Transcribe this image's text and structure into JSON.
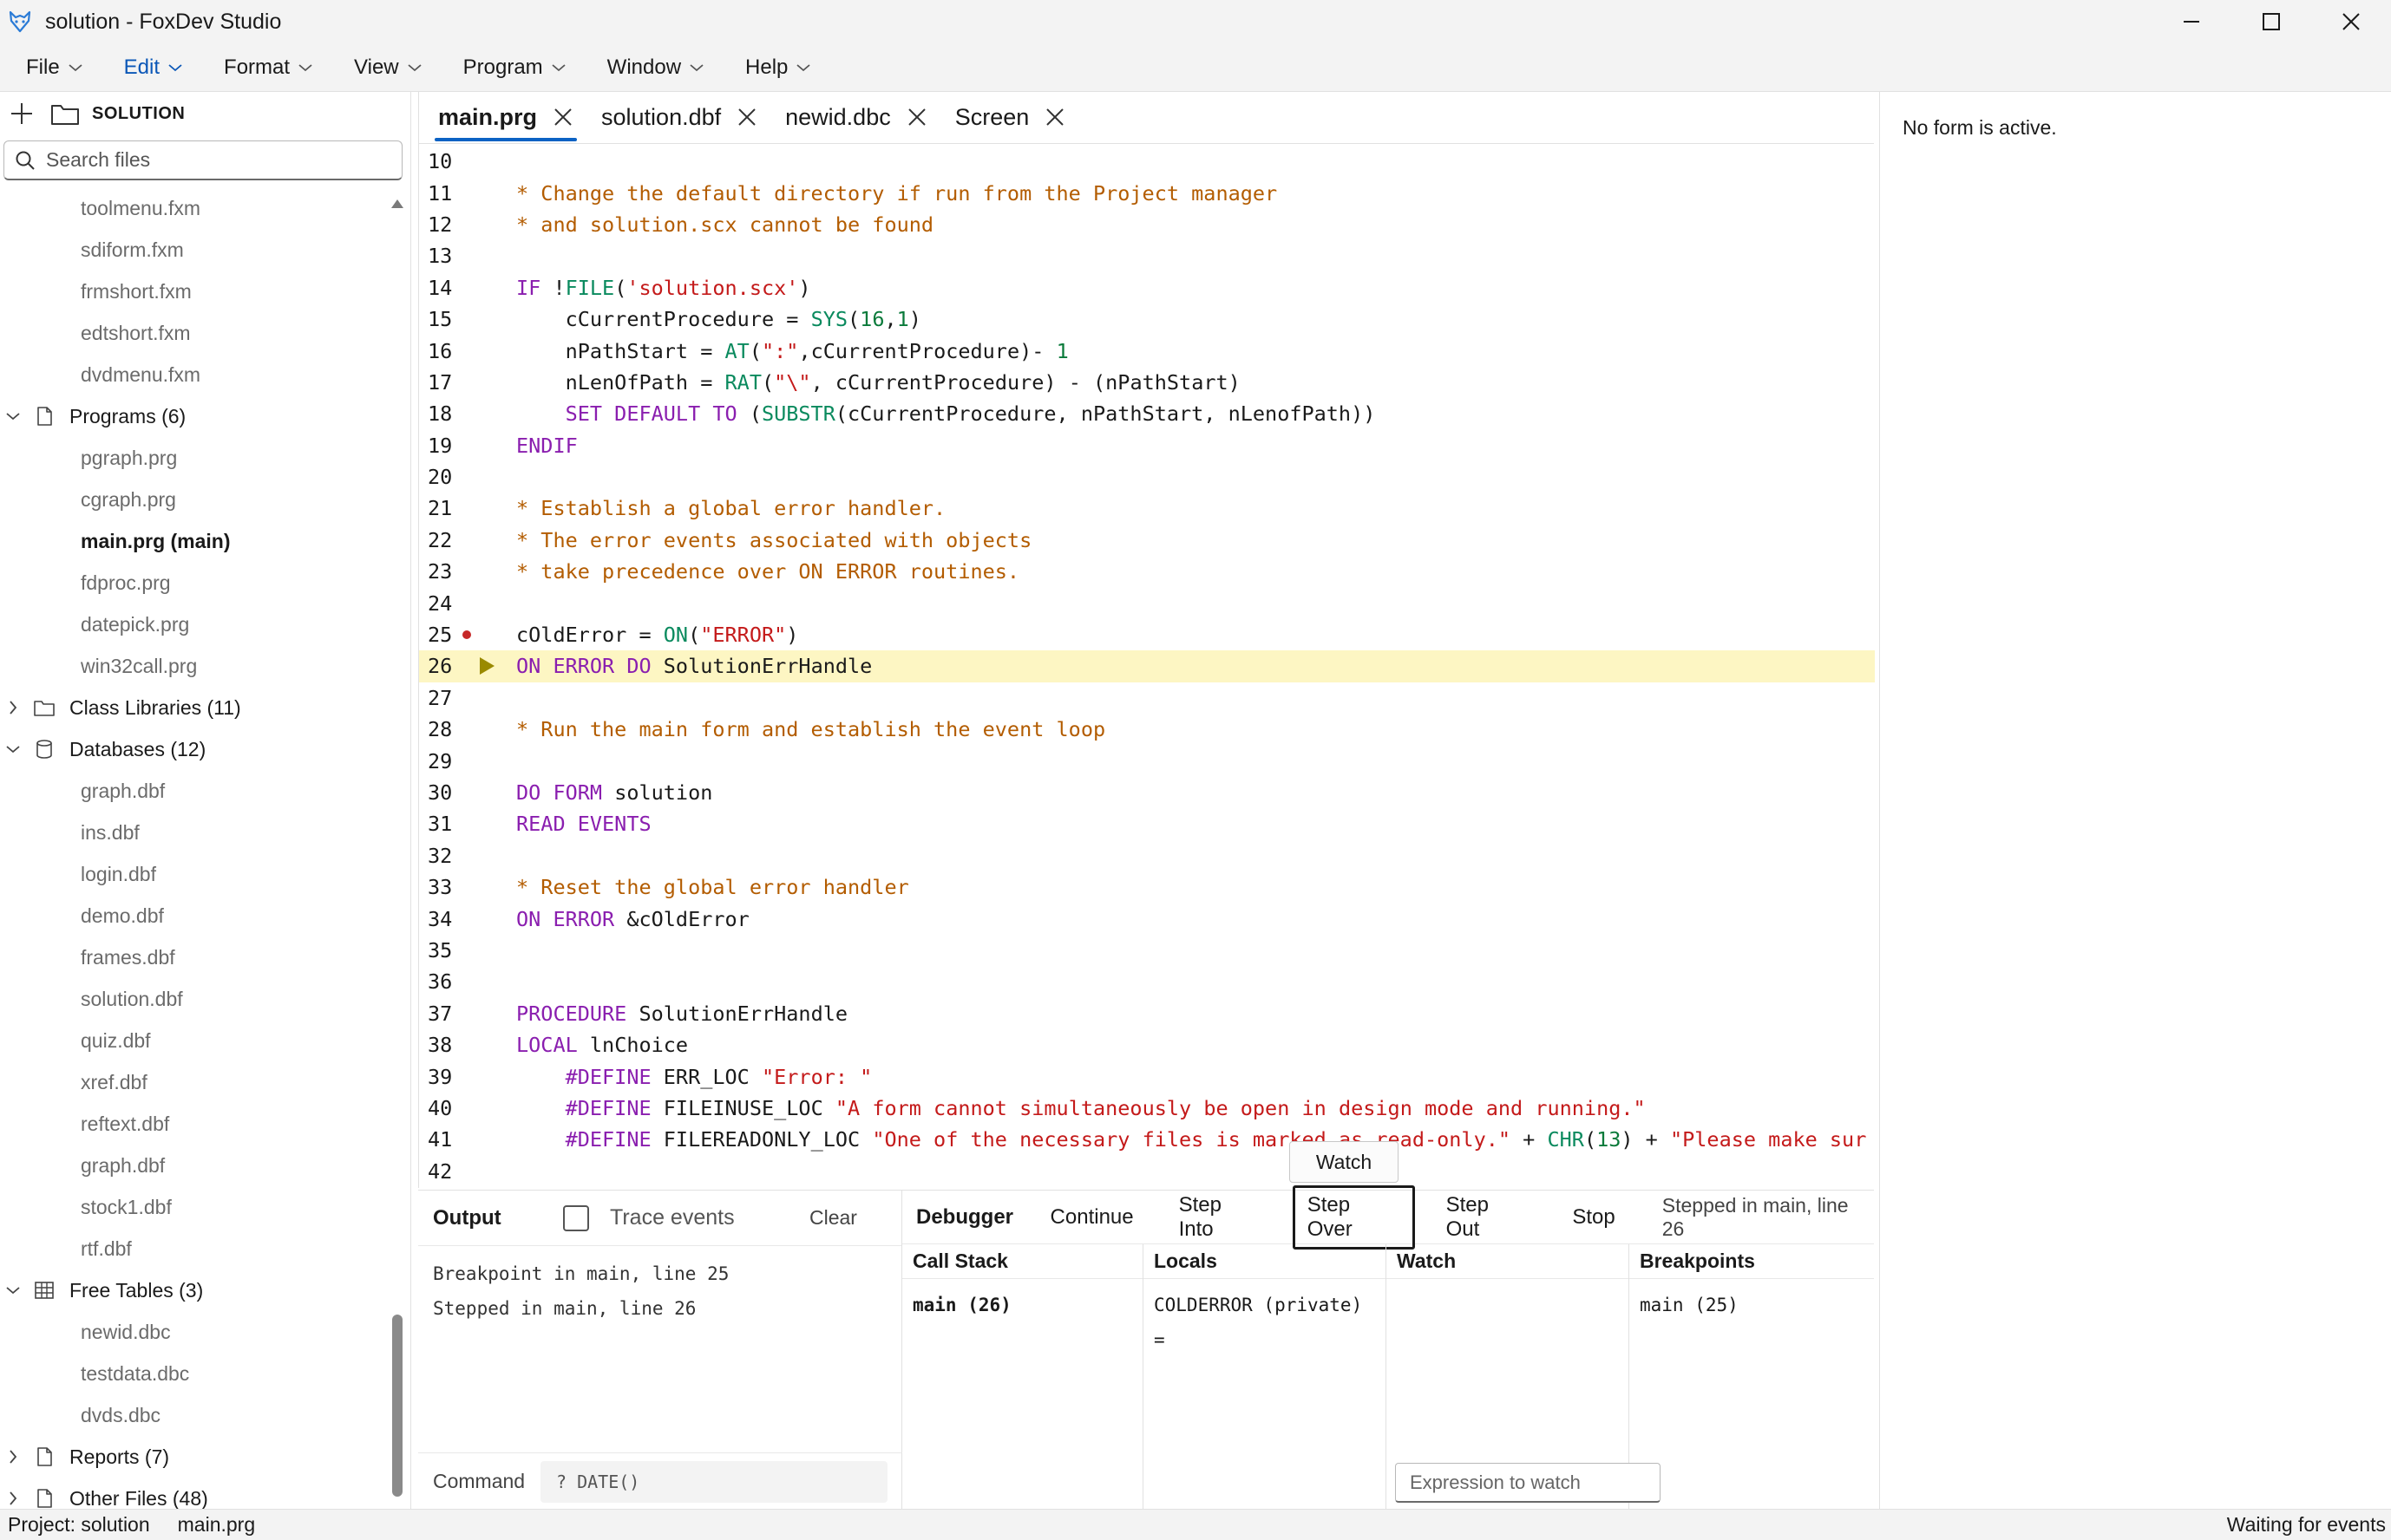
{
  "window": {
    "title": "solution - FoxDev Studio"
  },
  "menu": [
    {
      "label": "File"
    },
    {
      "label": "Edit"
    },
    {
      "label": "Format"
    },
    {
      "label": "View"
    },
    {
      "label": "Program"
    },
    {
      "label": "Window"
    },
    {
      "label": "Help"
    }
  ],
  "sidebar": {
    "project_label": "SOLUTION",
    "search_placeholder": "Search files",
    "forms_tail": [
      "toolmenu.fxm",
      "sdiform.fxm",
      "frmshort.fxm",
      "edtshort.fxm",
      "dvdmenu.fxm"
    ],
    "programs_label": "Programs (6)",
    "programs": [
      "pgraph.prg",
      "cgraph.prg",
      "main.prg (main)",
      "fdproc.prg",
      "datepick.prg",
      "win32call.prg"
    ],
    "class_libraries_label": "Class Libraries (11)",
    "databases_label": "Databases (12)",
    "databases": [
      "graph.dbf",
      "ins.dbf",
      "login.dbf",
      "demo.dbf",
      "frames.dbf",
      "solution.dbf",
      "quiz.dbf",
      "xref.dbf",
      "reftext.dbf",
      "graph.dbf",
      "stock1.dbf",
      "rtf.dbf"
    ],
    "free_tables_label": "Free Tables (3)",
    "free_tables": [
      "newid.dbc",
      "testdata.dbc",
      "dvds.dbc"
    ],
    "reports_label": "Reports (7)",
    "other_files_label": "Other Files (48)"
  },
  "tabs": [
    {
      "label": "main.prg"
    },
    {
      "label": "solution.dbf"
    },
    {
      "label": "newid.dbc"
    },
    {
      "label": "Screen"
    }
  ],
  "code": {
    "lines": [
      {
        "n": "10",
        "parts": []
      },
      {
        "n": "11",
        "parts": [
          {
            "c": "cm",
            "t": "* Change the default directory if run from the Project manager"
          }
        ]
      },
      {
        "n": "12",
        "parts": [
          {
            "c": "cm",
            "t": "* and solution.scx cannot be found"
          }
        ]
      },
      {
        "n": "13",
        "parts": []
      },
      {
        "n": "14",
        "parts": [
          {
            "c": "kw",
            "t": "IF"
          },
          {
            "c": "pl",
            "t": " !"
          },
          {
            "c": "fn",
            "t": "FILE"
          },
          {
            "c": "pl",
            "t": "("
          },
          {
            "c": "st",
            "t": "'solution.scx'"
          },
          {
            "c": "pl",
            "t": ")"
          }
        ]
      },
      {
        "n": "15",
        "parts": [
          {
            "c": "pl",
            "t": "    cCurrentProcedure = "
          },
          {
            "c": "fn",
            "t": "SYS"
          },
          {
            "c": "pl",
            "t": "("
          },
          {
            "c": "nm",
            "t": "16"
          },
          {
            "c": "pl",
            "t": ","
          },
          {
            "c": "nm",
            "t": "1"
          },
          {
            "c": "pl",
            "t": ")"
          }
        ]
      },
      {
        "n": "16",
        "parts": [
          {
            "c": "pl",
            "t": "    nPathStart = "
          },
          {
            "c": "fn",
            "t": "AT"
          },
          {
            "c": "pl",
            "t": "("
          },
          {
            "c": "st",
            "t": "\":\""
          },
          {
            "c": "pl",
            "t": ",cCurrentProcedure)- "
          },
          {
            "c": "nm",
            "t": "1"
          }
        ]
      },
      {
        "n": "17",
        "parts": [
          {
            "c": "pl",
            "t": "    nLenOfPath = "
          },
          {
            "c": "fn",
            "t": "RAT"
          },
          {
            "c": "pl",
            "t": "("
          },
          {
            "c": "st",
            "t": "\"\\\""
          },
          {
            "c": "pl",
            "t": ", cCurrentProcedure) - (nPathStart)"
          }
        ]
      },
      {
        "n": "18",
        "parts": [
          {
            "c": "pl",
            "t": "    "
          },
          {
            "c": "kw",
            "t": "SET DEFAULT TO"
          },
          {
            "c": "pl",
            "t": " ("
          },
          {
            "c": "fn",
            "t": "SUBSTR"
          },
          {
            "c": "pl",
            "t": "(cCurrentProcedure, nPathStart, nLenofPath))"
          }
        ]
      },
      {
        "n": "19",
        "parts": [
          {
            "c": "kw",
            "t": "ENDIF"
          }
        ]
      },
      {
        "n": "20",
        "parts": []
      },
      {
        "n": "21",
        "parts": [
          {
            "c": "cm",
            "t": "* Establish a global error handler."
          }
        ]
      },
      {
        "n": "22",
        "parts": [
          {
            "c": "cm",
            "t": "* The error events associated with objects"
          }
        ]
      },
      {
        "n": "23",
        "parts": [
          {
            "c": "cm",
            "t": "* take precedence over ON ERROR routines."
          }
        ]
      },
      {
        "n": "24",
        "parts": []
      },
      {
        "n": "25",
        "bp": true,
        "parts": [
          {
            "c": "pl",
            "t": "cOldError = "
          },
          {
            "c": "fn",
            "t": "ON"
          },
          {
            "c": "pl",
            "t": "("
          },
          {
            "c": "st",
            "t": "\"ERROR\""
          },
          {
            "c": "pl",
            "t": ")"
          }
        ]
      },
      {
        "n": "26",
        "current": true,
        "parts": [
          {
            "c": "kw",
            "t": "ON ERROR DO"
          },
          {
            "c": "pl",
            "t": " SolutionErrHandle"
          }
        ]
      },
      {
        "n": "27",
        "parts": []
      },
      {
        "n": "28",
        "parts": [
          {
            "c": "cm",
            "t": "* Run the main form and establish the event loop"
          }
        ]
      },
      {
        "n": "29",
        "parts": []
      },
      {
        "n": "30",
        "parts": [
          {
            "c": "kw",
            "t": "DO FORM"
          },
          {
            "c": "pl",
            "t": " solution"
          }
        ]
      },
      {
        "n": "31",
        "parts": [
          {
            "c": "kw",
            "t": "READ EVENTS"
          }
        ]
      },
      {
        "n": "32",
        "parts": []
      },
      {
        "n": "33",
        "parts": [
          {
            "c": "cm",
            "t": "* Reset the global error handler"
          }
        ]
      },
      {
        "n": "34",
        "parts": [
          {
            "c": "kw",
            "t": "ON ERROR"
          },
          {
            "c": "pl",
            "t": " &cOldError"
          }
        ]
      },
      {
        "n": "35",
        "parts": []
      },
      {
        "n": "36",
        "parts": []
      },
      {
        "n": "37",
        "parts": [
          {
            "c": "kw",
            "t": "PROCEDURE"
          },
          {
            "c": "pl",
            "t": " SolutionErrHandle"
          }
        ]
      },
      {
        "n": "38",
        "parts": [
          {
            "c": "kw",
            "t": "LOCAL"
          },
          {
            "c": "pl",
            "t": " lnChoice"
          }
        ]
      },
      {
        "n": "39",
        "parts": [
          {
            "c": "pl",
            "t": "    "
          },
          {
            "c": "kw",
            "t": "#DEFINE"
          },
          {
            "c": "pl",
            "t": " ERR_LOC "
          },
          {
            "c": "st",
            "t": "\"Error: \""
          }
        ]
      },
      {
        "n": "40",
        "parts": [
          {
            "c": "pl",
            "t": "    "
          },
          {
            "c": "kw",
            "t": "#DEFINE"
          },
          {
            "c": "pl",
            "t": " FILEINUSE_LOC "
          },
          {
            "c": "st",
            "t": "\"A form cannot simultaneously be open in design mode and running.\""
          }
        ]
      },
      {
        "n": "41",
        "parts": [
          {
            "c": "pl",
            "t": "    "
          },
          {
            "c": "kw",
            "t": "#DEFINE"
          },
          {
            "c": "pl",
            "t": " FILEREADONLY_LOC "
          },
          {
            "c": "st",
            "t": "\"One of the necessary files is marked as read-only.\""
          },
          {
            "c": "pl",
            "t": " + "
          },
          {
            "c": "fn",
            "t": "CHR"
          },
          {
            "c": "pl",
            "t": "("
          },
          {
            "c": "nm",
            "t": "13"
          },
          {
            "c": "pl",
            "t": ") + "
          },
          {
            "c": "st",
            "t": "\"Please make sur"
          }
        ]
      },
      {
        "n": "42",
        "parts": []
      }
    ]
  },
  "output": {
    "label": "Output",
    "trace_label": "Trace events",
    "trace_checked": false,
    "clear_label": "Clear",
    "lines": [
      "Breakpoint in main, line 25",
      "Stepped in main, line 26"
    ],
    "command_label": "Command",
    "command_placeholder": "? DATE()"
  },
  "debugger": {
    "label": "Debugger",
    "continue_label": "Continue",
    "step_into_label": "Step Into",
    "step_over_label": "Step Over",
    "step_out_label": "Step Out",
    "stop_label": "Stop",
    "status": "Stepped in main, line 26",
    "call_stack_header": "Call Stack",
    "call_stack_value": "main (26)",
    "locals_header": "Locals",
    "locals_value": "COLDERROR (private) =",
    "watch_header": "Watch",
    "watch_placeholder": "Expression to watch",
    "watch_button": "Watch",
    "breakpoints_header": "Breakpoints",
    "breakpoints_value": "main (25)"
  },
  "right_pane": {
    "message": "No form is active."
  },
  "status": {
    "project": "Project: solution",
    "file": "main.prg",
    "state": "Waiting for events"
  },
  "colors": {
    "accent": "#0b62c4",
    "current_line": "#fdf6c3",
    "breakpoint": "#c62828"
  }
}
